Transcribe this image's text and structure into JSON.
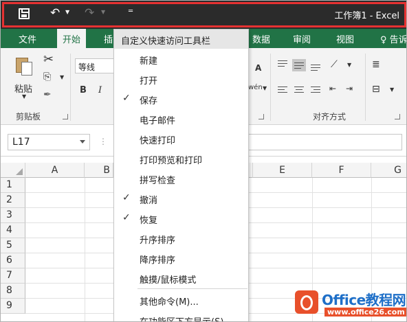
{
  "title_bar": {
    "title": "工作簿1 - Excel",
    "qat": {
      "save_icon": "save-icon",
      "undo_icon": "undo-icon",
      "redo_icon": "redo-icon",
      "customize_icon": "customize-qat-icon"
    }
  },
  "tabs": [
    {
      "label": "文件"
    },
    {
      "label": "开始"
    },
    {
      "label": "插"
    },
    {
      "label": "数据"
    },
    {
      "label": "审阅"
    },
    {
      "label": "视图"
    },
    {
      "label": "告诉"
    }
  ],
  "ribbon": {
    "paste_label": "粘贴",
    "clipboard_group": "剪贴板",
    "font_name": "等线",
    "bold": "B",
    "italic": "I",
    "font_size_up": "A",
    "phonetic": "wén",
    "alignment_group": "对齐方式"
  },
  "name_box": {
    "value": "L17"
  },
  "grid": {
    "columns": [
      "A",
      "B",
      "",
      "",
      "E",
      "F",
      "G"
    ],
    "rows": [
      "1",
      "2",
      "3",
      "4",
      "5",
      "6",
      "7",
      "8",
      "9"
    ]
  },
  "qat_menu": {
    "header": "自定义快速访问工具栏",
    "items": [
      {
        "label": "新建",
        "checked": false
      },
      {
        "label": "打开",
        "checked": false
      },
      {
        "label": "保存",
        "checked": true
      },
      {
        "label": "电子邮件",
        "checked": false
      },
      {
        "label": "快速打印",
        "checked": false
      },
      {
        "label": "打印预览和打印",
        "checked": false
      },
      {
        "label": "拼写检查",
        "checked": false
      },
      {
        "label": "撤消",
        "checked": true
      },
      {
        "label": "恢复",
        "checked": true
      },
      {
        "label": "升序排序",
        "checked": false
      },
      {
        "label": "降序排序",
        "checked": false
      },
      {
        "label": "触摸/鼠标模式",
        "checked": false
      },
      {
        "label": "其他命令(M)...",
        "checked": false
      },
      {
        "label": "在功能区下方显示(S)",
        "checked": false
      }
    ],
    "check_mark": "✓"
  },
  "watermark": {
    "name": "Office教程网",
    "url": "www.office26.com"
  },
  "colors": {
    "excel_green": "#217346",
    "title_dark": "#2b2b2b",
    "highlight_red": "#e63232"
  }
}
